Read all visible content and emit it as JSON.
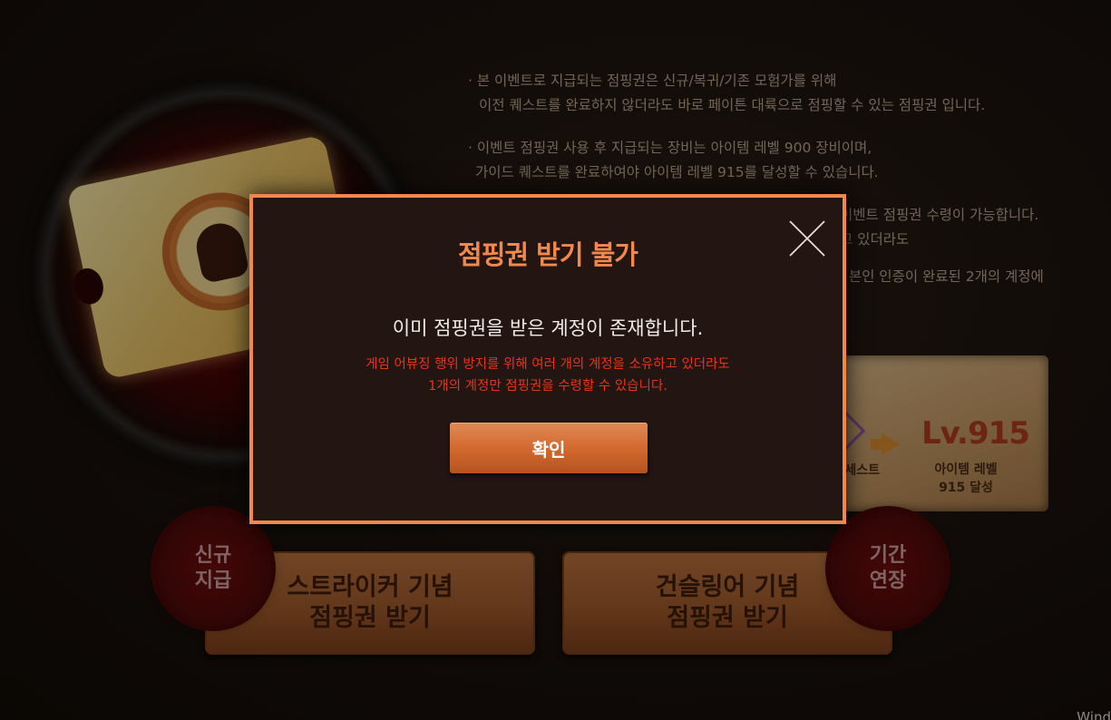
{
  "notices": [
    {
      "line1": "· 본 이벤트로 지급되는 점핑권은 신규/복귀/기존 모험가를 위해",
      "line2": "이전 퀘스트를 완료하지 않더라도 바로 페이튼 대륙으로 점핑할 수 있는 점핑권 입니다."
    },
    {
      "line1": "· 이벤트 점핑권 사용 후 지급되는 장비는 아이템 레벨 900 장비이며,",
      "line2": "가이드 퀘스트를 완료하여야 아이템 레벨 915를 달성할 수 있습니다."
    },
    {
      "line1": "이벤트 점핑권 수령이 가능합니다.",
      "line2": "고 있더라도"
    },
    {
      "line1": ", 본인 인증이 완료된 2개의 계정에",
      "line2": ""
    }
  ],
  "progress_card": {
    "quest_label": "세스트",
    "level_badge": "Lv.915",
    "level_desc_1": "아이템 레벨",
    "level_desc_2": "915 달성"
  },
  "buttons": {
    "striker": {
      "line1": "스트라이커 기념",
      "line2": "점핑권 받기"
    },
    "gunslinger": {
      "line1": "건슬링어 기념",
      "line2": "점핑권 받기"
    }
  },
  "seals": {
    "new": {
      "line1": "신규",
      "line2": "지급"
    },
    "extended": {
      "line1": "기간",
      "line2": "연장"
    }
  },
  "modal": {
    "title": "점핑권 받기 불가",
    "message": "이미 점핑권을 받은 계정이 존재합니다.",
    "warning_line1": "게임 어뷰징 행위 방지를 위해 여러 개의 계정을 소유하고 있더라도",
    "warning_line2": "1개의 계정만 점핑권을 수령할 수 있습니다.",
    "confirm_label": "확인",
    "close_icon": "close-icon"
  },
  "watermark": "Wind",
  "colors": {
    "accent": "#f0874c",
    "warning": "#e8341c",
    "modal_bg": "#221512",
    "confirm": "#d36a30"
  }
}
